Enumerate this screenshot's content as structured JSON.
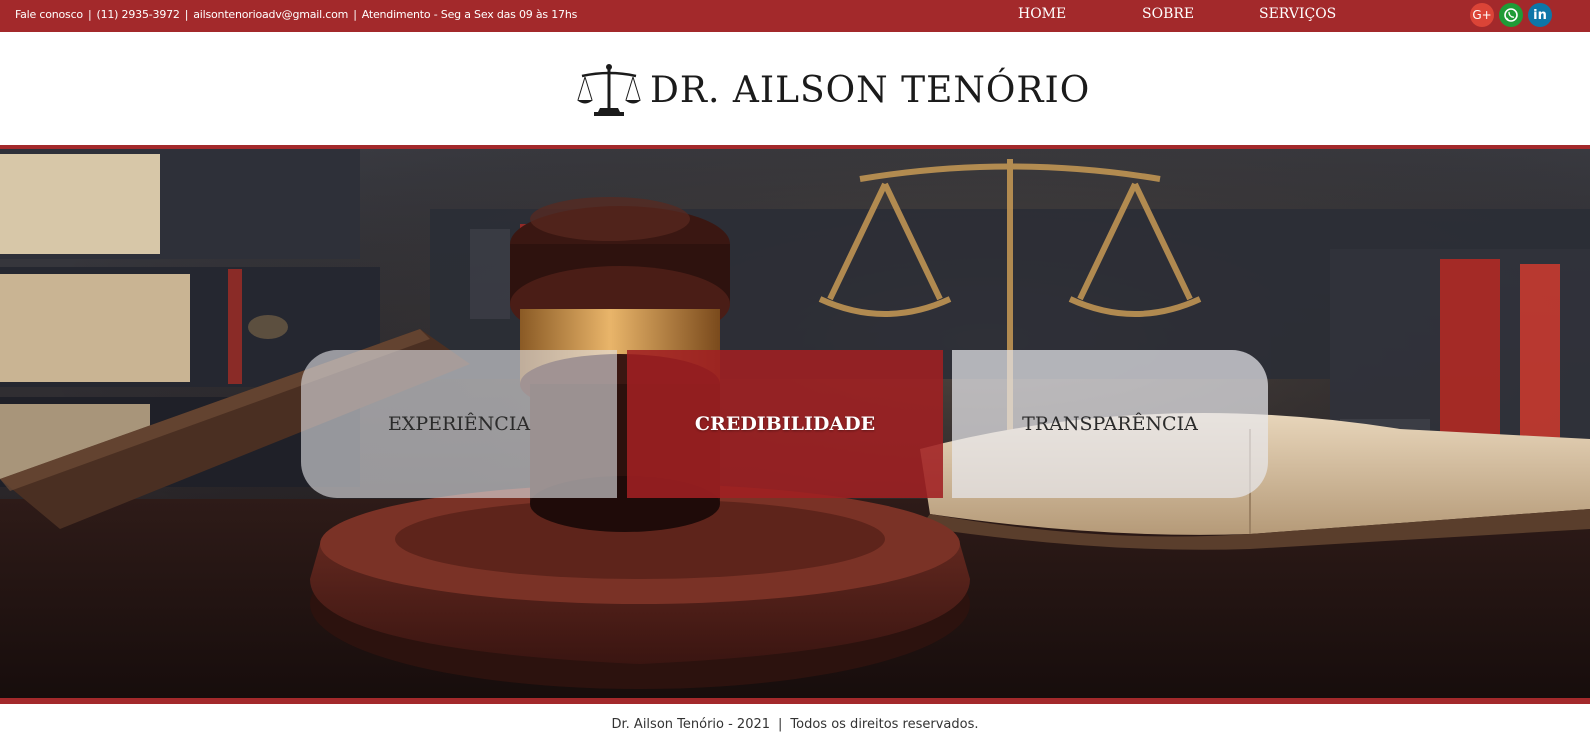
{
  "topbar": {
    "contact_label": "Fale conosco",
    "phone": "(11) 2935-3972",
    "email": "ailsontenorioadv@gmail.com",
    "hours": "Atendimento - Seg a Sex das 09 às 17hs",
    "separator": "|"
  },
  "nav": {
    "home": "HOME",
    "sobre": "SOBRE",
    "servicos": "SERVIÇOS"
  },
  "social": {
    "gplus": "G+",
    "whatsapp_icon": "whatsapp-icon",
    "linkedin": "in"
  },
  "header": {
    "logo_icon": "scales-of-justice-icon",
    "title": "DR. AILSON TENÓRIO"
  },
  "hero": {
    "background": "gavel-scales-books-photo",
    "cards": [
      {
        "label": "EXPERIÊNCIA"
      },
      {
        "label": "CREDIBILIDADE"
      },
      {
        "label": "TRANSPARÊNCIA"
      }
    ]
  },
  "footer": {
    "text": "Dr. Ailson Tenório - 2021",
    "separator": "|",
    "rights": "Todos os direitos reservados."
  },
  "colors": {
    "brand_red": "#a3292b",
    "text_dark": "#1b1b1b",
    "white": "#ffffff"
  }
}
